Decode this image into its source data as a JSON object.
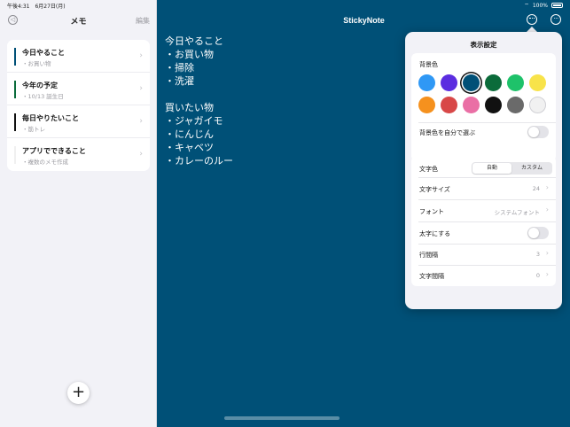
{
  "status": {
    "time": "午後4:31　6月27日(月)",
    "battery": "100%"
  },
  "sidebar": {
    "title": "メモ",
    "edit": "編集",
    "notes": [
      {
        "title": "今日やること",
        "subtitle": "・お買い物",
        "color": "#005077"
      },
      {
        "title": "今年の予定",
        "subtitle": "・10/13 誕生日",
        "color": "#0a6b3b"
      },
      {
        "title": "毎日やりたいこと",
        "subtitle": "・筋トレ",
        "color": "#111111"
      },
      {
        "title": "アプリでできること",
        "subtitle": "・複数のメモ作成",
        "color": "#f0f0f0"
      }
    ],
    "add_icon": "plus-icon"
  },
  "main": {
    "app_title": "StickyNote",
    "background": "#005077",
    "note_lines": [
      "今日やること",
      "・お買い物",
      "・掃除",
      "・洗濯",
      "",
      "買いたい物",
      "・ジャガイモ",
      "・にんじん",
      "・キャベツ",
      "・カレーのルー"
    ]
  },
  "settings": {
    "title": "表示設定",
    "bg_color_label": "背景色",
    "swatches": [
      "#2f98f5",
      "#5b2de0",
      "#005077",
      "#0b6b3a",
      "#1ec26a",
      "#f8e34a",
      "#f5911e",
      "#d84848",
      "#ea6fa5",
      "#111111",
      "#6a6a6a",
      "#f1f1f1"
    ],
    "selected_swatch": 2,
    "custom_bg_label": "背景色を自分で選ぶ",
    "custom_bg_on": false,
    "text_color_label": "文字色",
    "text_color_options": [
      "自動",
      "カスタム"
    ],
    "text_color_selected": 0,
    "rows": [
      {
        "label": "文字サイズ",
        "value": "24"
      },
      {
        "label": "フォント",
        "value": "システムフォント"
      },
      {
        "label": "太字にする",
        "value": ""
      },
      {
        "label": "行間隔",
        "value": "3"
      },
      {
        "label": "文字間隔",
        "value": "0"
      }
    ],
    "bold_on": false
  }
}
